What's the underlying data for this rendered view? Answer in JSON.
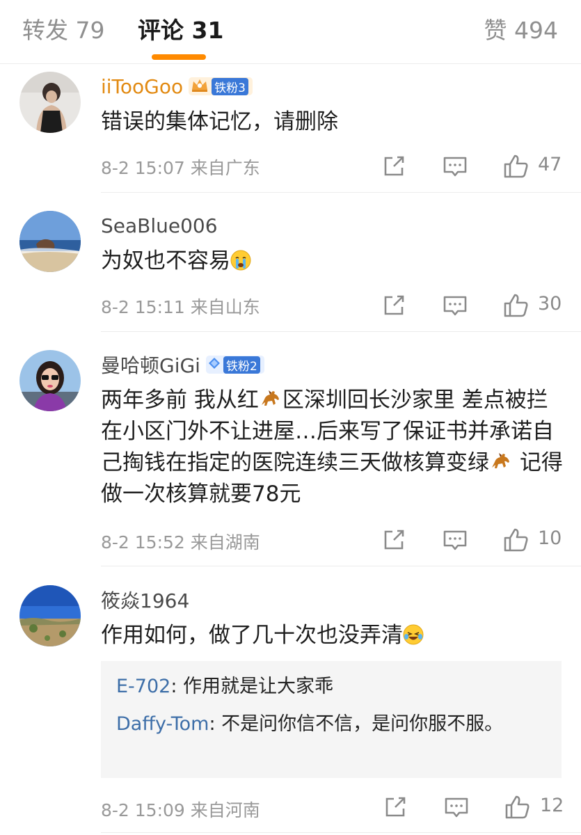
{
  "tabs": {
    "repost": "转发 79",
    "comment": "评论 31",
    "like": "赞 494"
  },
  "comments": [
    {
      "username": "iiTooGoo",
      "badge": "铁粉3",
      "text": "错误的集体记忆，请删除",
      "time": "8-2 15:07",
      "location": "来自广东",
      "likes": "47"
    },
    {
      "username": "SeaBlue006",
      "text": "为奴也不容易",
      "emoji": "crying-face",
      "time": "8-2 15:11",
      "location": "来自山东",
      "likes": "30"
    },
    {
      "username": "曼哈顿GiGi",
      "badge": "铁粉2",
      "text_parts": [
        "两年多前 我从红",
        "区深圳回长沙家里 差点被拦在小区门外不让进屋…后来写了保证书并承诺自己掏钱在指定的医院连续三天做核算变绿",
        " 记得做一次核算就要78元"
      ],
      "emoji": "horse",
      "time": "8-2 15:52",
      "location": "来自湖南",
      "likes": "10"
    },
    {
      "username": "筱焱1964",
      "text": "作用如何，做了几十次也没弄清",
      "emoji": "laughing-face",
      "replies": [
        {
          "user": "E-702",
          "text": ": 作用就是让大家乖"
        },
        {
          "user": "Daffy-Tom",
          "text": ": 不是问你信不信，是问你服不服。"
        }
      ],
      "time": "8-2 15:09",
      "location": "来自河南",
      "likes": "12"
    }
  ],
  "colors": {
    "accent": "#ff8a00",
    "gold_username": "#e28a12",
    "link_blue": "#3d6ea8",
    "meta_gray": "#999999"
  }
}
